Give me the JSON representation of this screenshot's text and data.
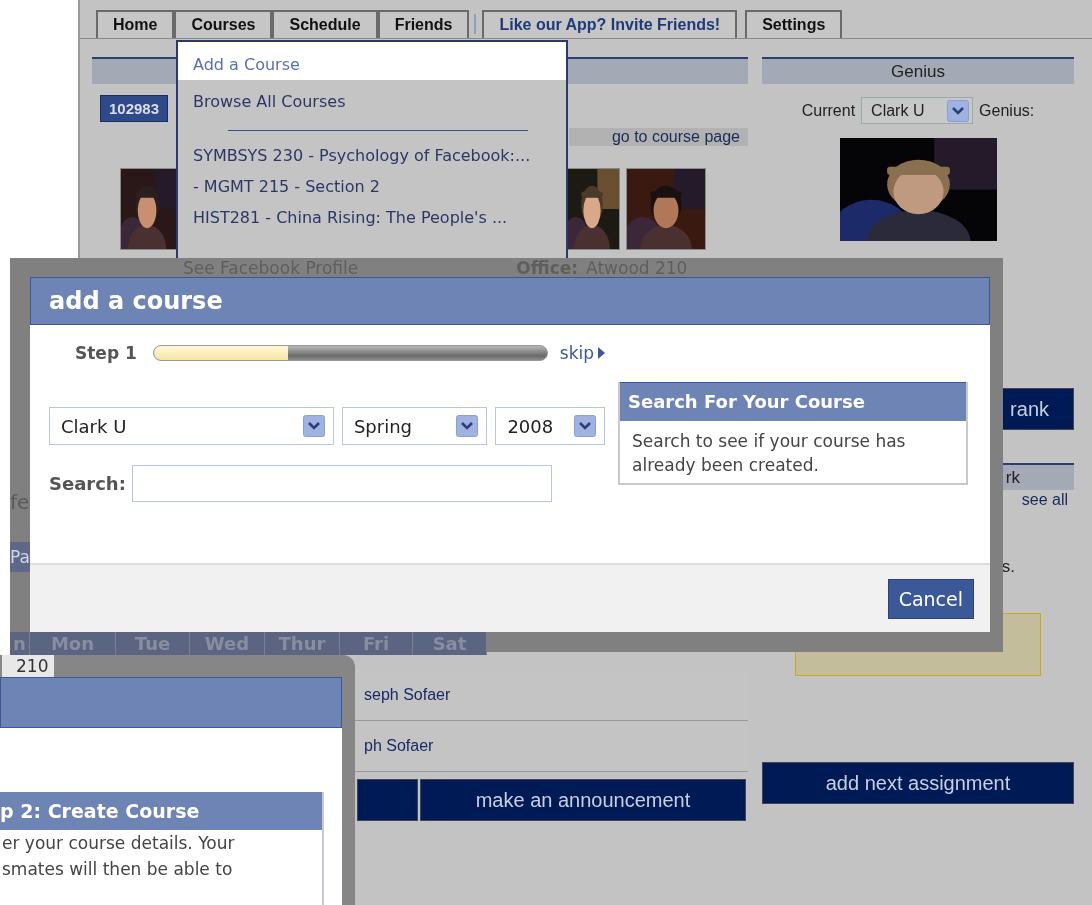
{
  "nav": {
    "tabs": [
      {
        "label": "Home",
        "kind": "tab"
      },
      {
        "label": "Courses",
        "kind": "tab"
      },
      {
        "label": "Schedule",
        "kind": "tab"
      },
      {
        "label": "Friends",
        "kind": "tab"
      },
      {
        "label": "Like our App? Invite Friends!",
        "kind": "invite"
      },
      {
        "label": "Settings",
        "kind": "tab"
      }
    ]
  },
  "courses_menu": {
    "items": [
      {
        "label": "Add a Course",
        "selected": true
      },
      {
        "label": "Browse All Courses",
        "selected": false
      }
    ],
    "courses": [
      "SYMBSYS 230 - Psychology of Facebook:...",
      "- MGMT 215 - Section 2",
      "HIST281 - China Rising: The People's ..."
    ]
  },
  "course_panel": {
    "course_tab": "102983",
    "course_link": "go to course page",
    "photos": [
      {
        "kind": "picture"
      },
      {
        "kind": "picture"
      },
      {
        "kind": "picture"
      }
    ],
    "rows": [
      "seph Sofaer",
      "ph Sofaer"
    ],
    "action_button": "make an announcement"
  },
  "genius_panel": {
    "title": "Genius",
    "current_label": "Current",
    "school": "Clark U",
    "genius_label": "Genius:",
    "photo": {
      "kind": "picture"
    },
    "rank_button": "rank",
    "homework_title": "rk",
    "see_all": "see all",
    "note_fragment": "s.",
    "next_button": "add next assignment"
  },
  "add_course_dialog": {
    "behind": {
      "profile_link": "See Facebook Profile",
      "office_label": "Office:",
      "office_value": "Atwood 210",
      "fragments": [
        "fe",
        "Pa"
      ],
      "day_headers": [
        "n",
        "Mon",
        "Tue",
        "Wed",
        "Thur",
        "Fri",
        "Sat"
      ]
    },
    "title": "add a course",
    "step_label": "Step 1",
    "level": 0.34,
    "skip_link": "skip",
    "selects": [
      {
        "value": "Clark U"
      },
      {
        "value": "Spring"
      },
      {
        "value": "2008"
      }
    ],
    "search_label": "Search:",
    "tip": {
      "title": "Search For Your Course",
      "text": "Search to see if your course has already been created."
    },
    "cancel_button": "Cancel"
  },
  "create_course_dialog": {
    "behind_text": "210",
    "step_title": "p 2: Create Course",
    "lines": [
      "er your course details. Your",
      "smates will then be able to"
    ]
  }
}
